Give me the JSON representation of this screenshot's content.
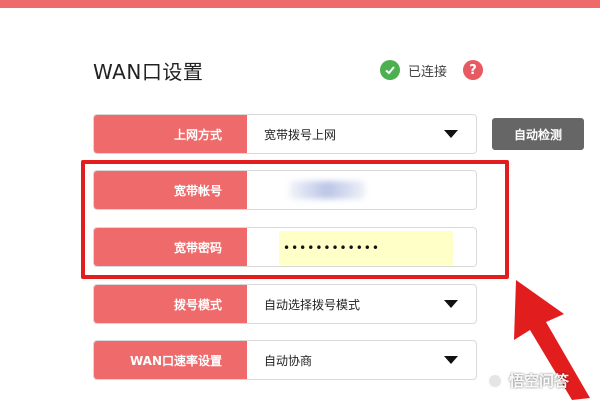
{
  "page": {
    "title": "WAN口设置",
    "status": "已连接",
    "help": "?"
  },
  "form": {
    "rows": [
      {
        "label": "上网方式",
        "value": "宽带拨号上网"
      },
      {
        "label": "宽带帐号",
        "value": ""
      },
      {
        "label": "宽带密码",
        "value": "••••••••••••"
      },
      {
        "label": "拨号模式",
        "value": "自动选择拨号模式"
      },
      {
        "label": "WAN口速率设置",
        "value": "自动协商"
      }
    ],
    "auto_detect_label": "自动检测"
  },
  "colors": {
    "accent": "#ef6a6a",
    "highlight": "#e21d1d",
    "status_ok": "#4caf50",
    "password_bg": "#ffffc8"
  },
  "watermark": "悟空问答"
}
